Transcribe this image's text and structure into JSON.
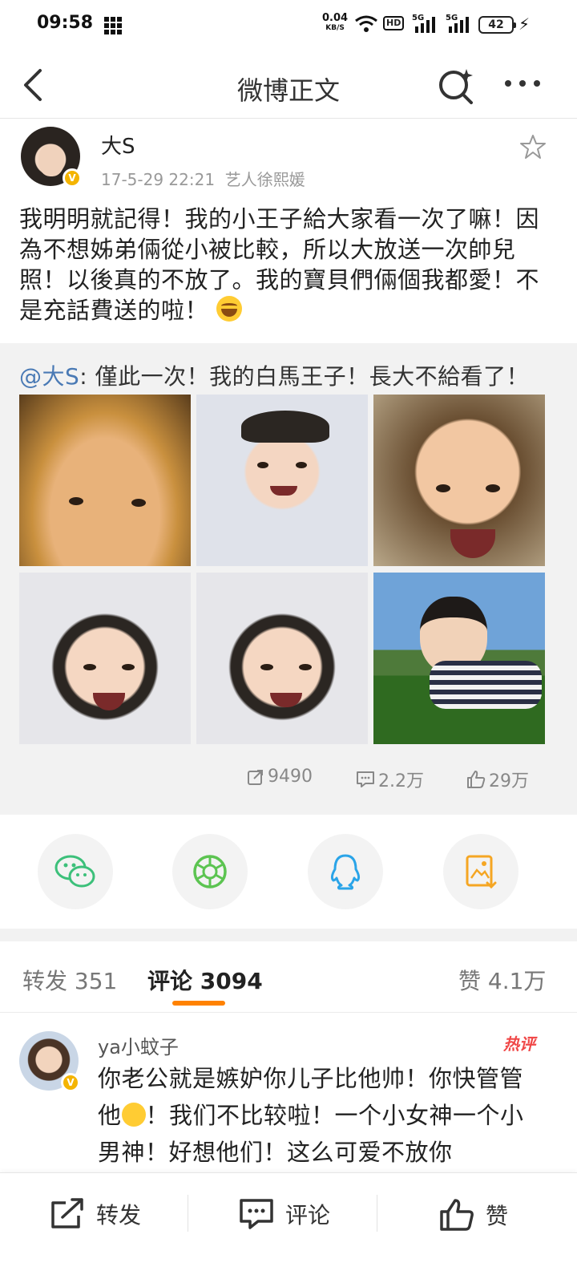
{
  "status_bar": {
    "time": "09:58",
    "net_speed": "0.04",
    "net_unit": "KB/S",
    "hd": "HD",
    "sig1": "5G",
    "sig2": "5G",
    "battery": "42"
  },
  "nav": {
    "title": "微博正文"
  },
  "post": {
    "author": "大S",
    "timestamp": "17-5-29 22:21",
    "source": "艺人徐熙媛",
    "text": "我明明就記得！我的小王子給大家看一次了嘛！因為不想姊弟倆從小被比較，所以大放送一次帥兒照！以後真的不放了。我的寶貝們倆個我都愛！不是充話費送的啦！"
  },
  "repost": {
    "mention": "@大S",
    "text": ": 僅此一次！我的白馬王子！長大不給看了！",
    "stats": {
      "reposts": "9490",
      "comments": "2.2万",
      "likes": "29万"
    }
  },
  "share": {
    "icons": [
      "wechat-icon",
      "moments-icon",
      "qq-icon",
      "save-image-icon"
    ]
  },
  "tabs": {
    "repost": "转发 351",
    "comments": "评论 3094",
    "likes": "赞 4.1万"
  },
  "comment": {
    "author": "ya小蚊子",
    "badge": "热评",
    "text_1": "你老公就是嫉妒你儿子比他帅！你快管管他",
    "text_2": "！我们不比较啦！一个小女神一个小男神！好想他们！这么可爱不放你"
  },
  "bottom_bar": {
    "repost": "转发",
    "comment": "评论",
    "like": "赞"
  },
  "colors": {
    "accent": "#ff8200",
    "link": "#4a7ab5",
    "hot": "#f04848"
  }
}
